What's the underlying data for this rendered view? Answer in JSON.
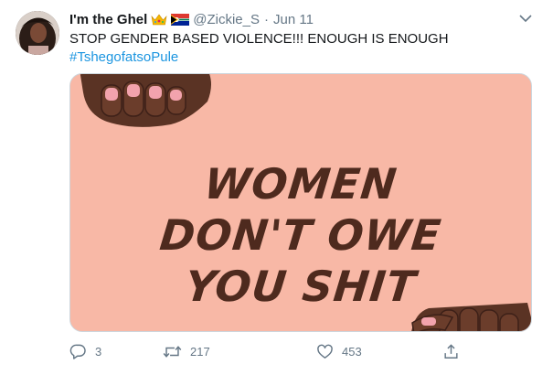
{
  "user": {
    "display_name": "I'm the Ghel",
    "handle": "@Zickie_S",
    "separator": "·",
    "date": "Jun 11"
  },
  "tweet": {
    "text": "STOP GENDER BASED VIOLENCE!!! ENOUGH IS ENOUGH",
    "hashtag": "#TshegofatsoPule"
  },
  "media": {
    "lines": [
      "WOMEN",
      "DON'T OWE",
      "YOU SHIT"
    ],
    "background_color": "#f8b8a6",
    "text_color": "#4e2a1e"
  },
  "actions": {
    "replies": "3",
    "retweets": "217",
    "likes": "453"
  },
  "colors": {
    "link": "#1b95e0",
    "muted": "#657786"
  }
}
